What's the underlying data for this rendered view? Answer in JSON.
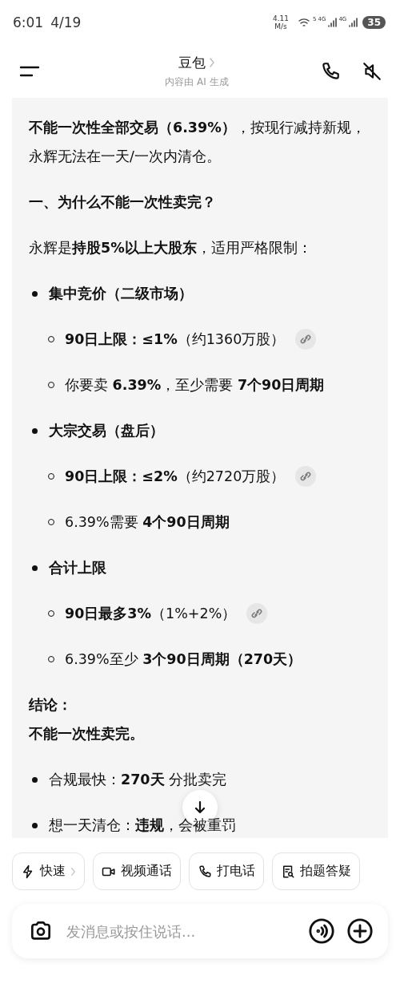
{
  "status_bar": {
    "time": "6:01",
    "date": "4/19",
    "speed_value": "4.11",
    "speed_unit": "M/s",
    "wifi_badge": "5",
    "network_1": "4G",
    "network_2": "4G",
    "battery": "35"
  },
  "header": {
    "title": "豆包",
    "subtitle": "内容由 AI 生成"
  },
  "message": [
    {
      "kind": "para",
      "text": "**不能一次性全部交易（6.39%）**，按现行减持新规，永辉无法在一天/一次内清仓。"
    },
    {
      "kind": "para",
      "bold": true,
      "text": "一、为什么不能一次性卖完？"
    },
    {
      "kind": "para",
      "text": "永辉是**持股5%以上大股东**，适用严格限制："
    },
    {
      "kind": "bullet",
      "bold": true,
      "text": "集中竞价（二级市场）"
    },
    {
      "kind": "subbullet",
      "text": "**90日上限：≤1%**（约1360万股）",
      "link": true
    },
    {
      "kind": "subbullet",
      "text": "你要卖 **6.39%**，至少需要 **7个90日周期**"
    },
    {
      "kind": "bullet",
      "bold": true,
      "text": "大宗交易（盘后）"
    },
    {
      "kind": "subbullet",
      "text": "**90日上限：≤2%**（约2720万股）",
      "link": true
    },
    {
      "kind": "subbullet",
      "text": "6.39%需要 **4个90日周期**"
    },
    {
      "kind": "bullet",
      "bold": true,
      "text": "合计上限"
    },
    {
      "kind": "subbullet",
      "text": "**90日最多3%**（1%+2%）",
      "link": true
    },
    {
      "kind": "subbullet",
      "text": "6.39%至少 **3个90日周期（270天）**"
    },
    {
      "kind": "caption",
      "bold": true,
      "text": "结论："
    },
    {
      "kind": "para",
      "bold": true,
      "text": "不能一次性卖完。"
    },
    {
      "kind": "bullet",
      "text": "合规最快：**270天** 分批卖完"
    },
    {
      "kind": "bullet",
      "text": "想一天清仓：**违规**，会被重罚"
    }
  ],
  "chips": [
    {
      "label": "快速",
      "chevron": true
    },
    {
      "label": "视频通话",
      "chevron": false
    },
    {
      "label": "打电话",
      "chevron": false
    },
    {
      "label": "拍题答疑",
      "chevron": false
    }
  ],
  "input": {
    "placeholder": "发消息或按住说话..."
  }
}
